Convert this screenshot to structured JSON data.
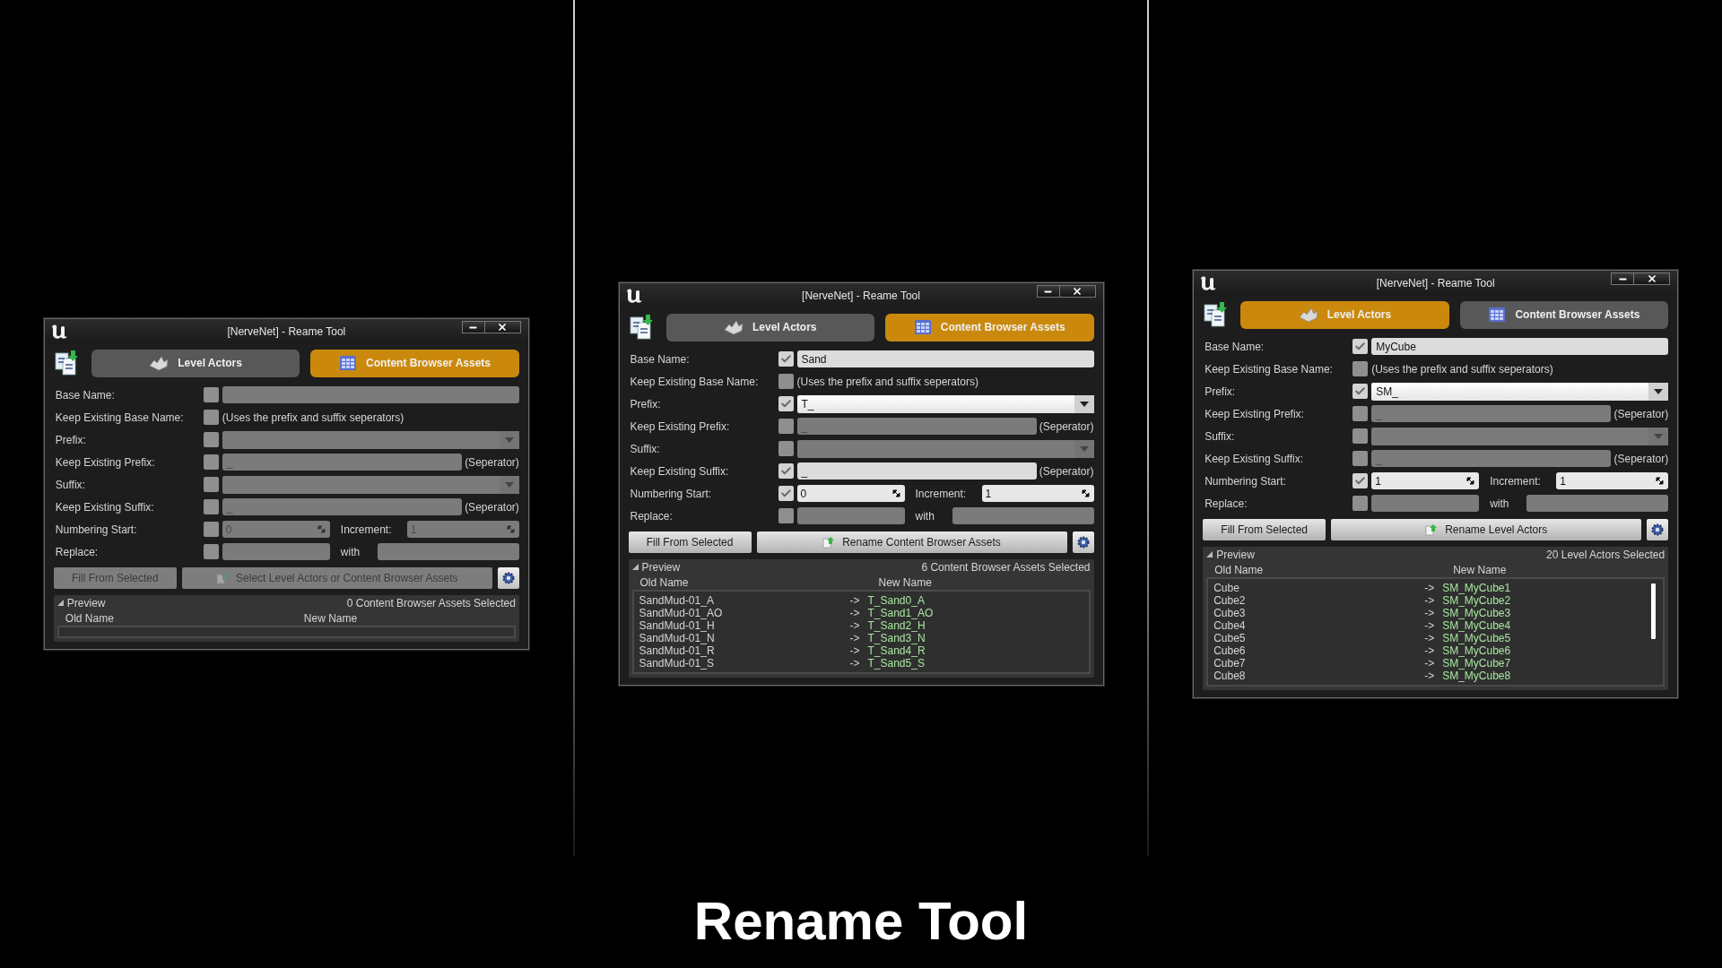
{
  "windows": [
    {
      "title": "[NerveNet] - Reame Tool",
      "tabs": [
        {
          "label": "Level Actors",
          "kind": "actors",
          "selected": false
        },
        {
          "label": "Content Browser Assets",
          "kind": "assets",
          "selected": true
        }
      ],
      "rows": [
        {
          "kind": "text",
          "label": "Base Name:",
          "checked": false
        },
        {
          "kind": "note",
          "label": "Keep Existing Base Name:",
          "checked": false,
          "note": "(Uses the prefix and suffix seperators)"
        },
        {
          "kind": "dropdown",
          "label": "Prefix:",
          "checked": false
        },
        {
          "kind": "separator",
          "label": "Keep Existing Prefix:",
          "checked": false,
          "value": "_",
          "note": "(Seperator)"
        },
        {
          "kind": "dropdown",
          "label": "Suffix:",
          "checked": false
        },
        {
          "kind": "separator",
          "label": "Keep Existing Suffix:",
          "checked": false,
          "value": "_",
          "note": "(Seperator)"
        },
        {
          "kind": "numbering",
          "label": "Numbering Start:",
          "checked": false,
          "value": "0",
          "second_label": "Increment:",
          "second_value": "1"
        },
        {
          "kind": "replace",
          "label": "Replace:",
          "checked": false,
          "second_label": "with"
        }
      ],
      "fill_button": "Fill From Selected",
      "action_button": {
        "label": "Select Level Actors or Content Browser Assets",
        "disabled": true
      },
      "preview": {
        "title": "Preview",
        "count": "0 Content Browser Assets Selected",
        "columns": [
          "Old Name",
          "New Name"
        ],
        "scrollable": false
      }
    },
    {
      "title": "[NerveNet] - Reame Tool",
      "tabs": [
        {
          "label": "Level Actors",
          "kind": "actors",
          "selected": false
        },
        {
          "label": "Content Browser Assets",
          "kind": "assets",
          "selected": true
        }
      ],
      "rows": [
        {
          "kind": "text",
          "label": "Base Name:",
          "checked": true,
          "value": "Sand"
        },
        {
          "kind": "note",
          "label": "Keep Existing Base Name:",
          "checked": false,
          "note": "(Uses the prefix and suffix seperators)"
        },
        {
          "kind": "dropdown",
          "label": "Prefix:",
          "checked": true,
          "value": "T_"
        },
        {
          "kind": "separator",
          "label": "Keep Existing Prefix:",
          "checked": false,
          "value": "_",
          "note": "(Seperator)"
        },
        {
          "kind": "dropdown",
          "label": "Suffix:",
          "checked": false
        },
        {
          "kind": "separator",
          "label": "Keep Existing Suffix:",
          "checked": true,
          "value": "_",
          "note": "(Seperator)"
        },
        {
          "kind": "numbering",
          "label": "Numbering Start:",
          "checked": true,
          "value": "0",
          "second_label": "Increment:",
          "second_value": "1"
        },
        {
          "kind": "replace",
          "label": "Replace:",
          "checked": false,
          "second_label": "with"
        }
      ],
      "fill_button": "Fill From Selected",
      "action_button": {
        "label": "Rename Content Browser Assets",
        "disabled": false
      },
      "preview": {
        "title": "Preview",
        "count": "6 Content Browser Assets Selected",
        "columns": [
          "Old Name",
          "New Name"
        ],
        "scrollable": false,
        "rows": [
          {
            "old": "SandMud-01_A",
            "arrow": "->",
            "new": "T_Sand0_A"
          },
          {
            "old": "SandMud-01_AO",
            "arrow": "->",
            "new": "T_Sand1_AO"
          },
          {
            "old": "SandMud-01_H",
            "arrow": "->",
            "new": "T_Sand2_H"
          },
          {
            "old": "SandMud-01_N",
            "arrow": "->",
            "new": "T_Sand3_N"
          },
          {
            "old": "SandMud-01_R",
            "arrow": "->",
            "new": "T_Sand4_R"
          },
          {
            "old": "SandMud-01_S",
            "arrow": "->",
            "new": "T_Sand5_S"
          }
        ]
      }
    },
    {
      "title": "[NerveNet] - Reame Tool",
      "tabs": [
        {
          "label": "Level Actors",
          "kind": "actors",
          "selected": true
        },
        {
          "label": "Content Browser Assets",
          "kind": "assets",
          "selected": false
        }
      ],
      "rows": [
        {
          "kind": "text",
          "label": "Base Name:",
          "checked": true,
          "value": "MyCube"
        },
        {
          "kind": "note",
          "label": "Keep Existing Base Name:",
          "checked": false,
          "note": "(Uses the prefix and suffix seperators)"
        },
        {
          "kind": "dropdown",
          "label": "Prefix:",
          "checked": true,
          "value": "SM_"
        },
        {
          "kind": "separator",
          "label": "Keep Existing Prefix:",
          "checked": false,
          "value": "_",
          "note": "(Seperator)"
        },
        {
          "kind": "dropdown",
          "label": "Suffix:",
          "checked": false
        },
        {
          "kind": "separator",
          "label": "Keep Existing Suffix:",
          "checked": false,
          "value": "_",
          "note": "(Seperator)"
        },
        {
          "kind": "numbering",
          "label": "Numbering Start:",
          "checked": true,
          "value": "1",
          "second_label": "Increment:",
          "second_value": "1"
        },
        {
          "kind": "replace",
          "label": "Replace:",
          "checked": false,
          "second_label": "with"
        }
      ],
      "fill_button": "Fill From Selected",
      "action_button": {
        "label": "Rename Level Actors",
        "disabled": false
      },
      "preview": {
        "title": "Preview",
        "count": "20 Level Actors Selected",
        "columns": [
          "Old Name",
          "New Name"
        ],
        "scrollable": true,
        "rows": [
          {
            "old": "Cube",
            "arrow": "->",
            "new": "SM_MyCube1"
          },
          {
            "old": "Cube2",
            "arrow": "->",
            "new": "SM_MyCube2"
          },
          {
            "old": "Cube3",
            "arrow": "->",
            "new": "SM_MyCube3"
          },
          {
            "old": "Cube4",
            "arrow": "->",
            "new": "SM_MyCube4"
          },
          {
            "old": "Cube5",
            "arrow": "->",
            "new": "SM_MyCube5"
          },
          {
            "old": "Cube6",
            "arrow": "->",
            "new": "SM_MyCube6"
          },
          {
            "old": "Cube7",
            "arrow": "->",
            "new": "SM_MyCube7"
          },
          {
            "old": "Cube8",
            "arrow": "->",
            "new": "SM_MyCube8"
          }
        ]
      }
    }
  ],
  "caption": "Rename Tool"
}
